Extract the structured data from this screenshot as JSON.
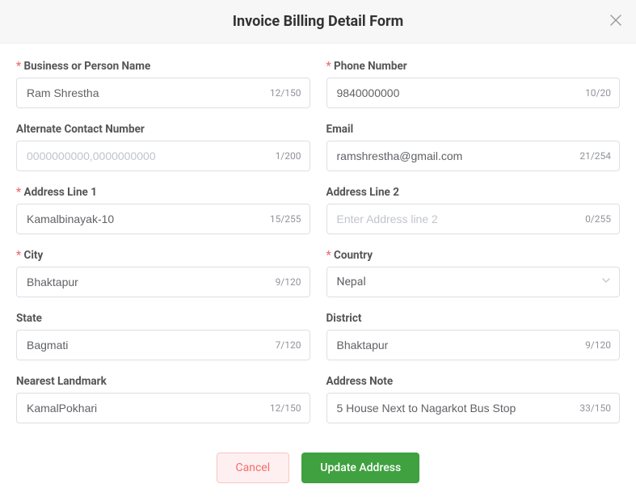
{
  "header": {
    "title": "Invoice Billing Detail Form"
  },
  "fields": {
    "business_name": {
      "label": "Business or Person Name",
      "value": "Ram Shrestha",
      "count": "12/150"
    },
    "phone": {
      "label": "Phone Number",
      "value": "9840000000",
      "count": "10/20"
    },
    "alt_contact": {
      "label": "Alternate Contact Number",
      "value": "",
      "placeholder": "0000000000,0000000000",
      "count": "1/200"
    },
    "email": {
      "label": "Email",
      "value": "ramshrestha@gmail.com",
      "count": "21/254"
    },
    "address1": {
      "label": "Address Line 1",
      "value": "Kamalbinayak-10",
      "count": "15/255"
    },
    "address2": {
      "label": "Address Line 2",
      "value": "",
      "placeholder": "Enter Address line 2",
      "count": "0/255"
    },
    "city": {
      "label": "City",
      "value": "Bhaktapur",
      "count": "9/120"
    },
    "country": {
      "label": "Country",
      "value": "Nepal"
    },
    "state": {
      "label": "State",
      "value": "Bagmati",
      "count": "7/120"
    },
    "district": {
      "label": "District",
      "value": "Bhaktapur",
      "count": "9/120"
    },
    "landmark": {
      "label": "Nearest Landmark",
      "value": "KamalPokhari",
      "count": "12/150"
    },
    "note": {
      "label": "Address Note",
      "value": "5 House Next to Nagarkot Bus Stop",
      "count": "33/150"
    }
  },
  "buttons": {
    "cancel": "Cancel",
    "submit": "Update Address"
  }
}
